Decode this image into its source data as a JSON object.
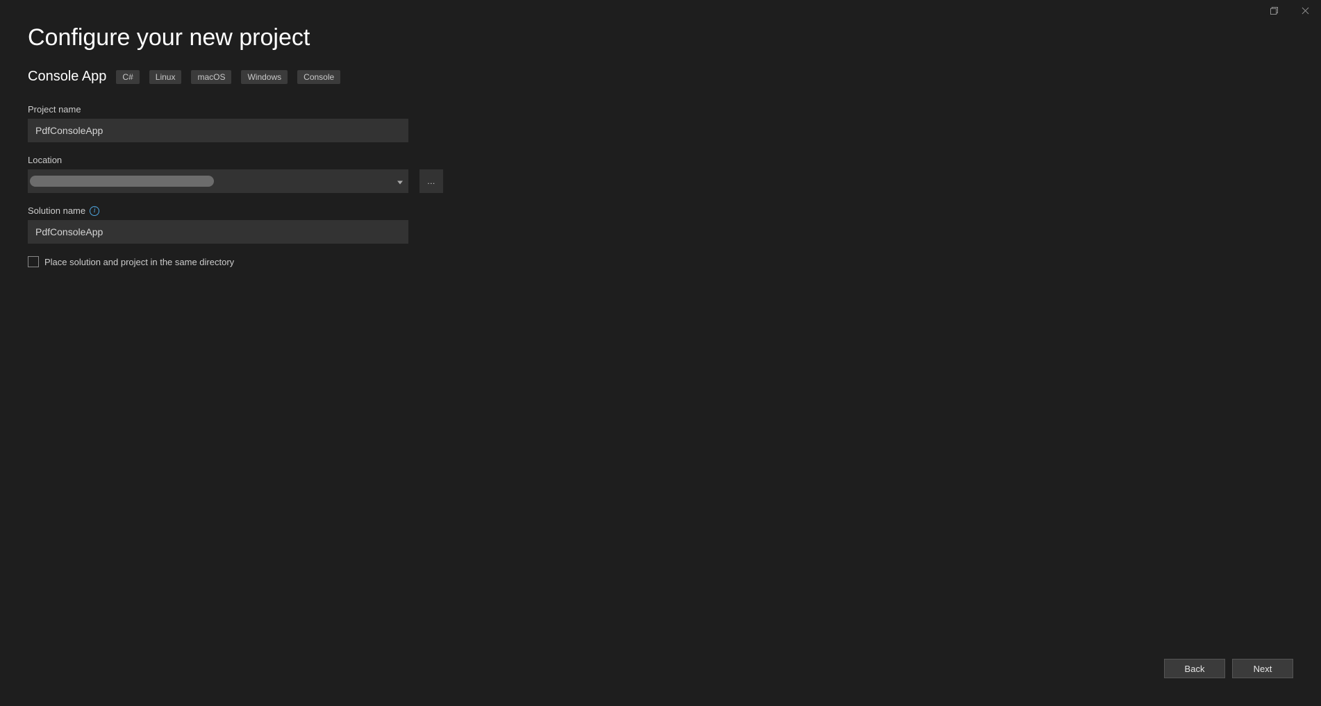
{
  "title_bar": {
    "maximize_icon": "maximize",
    "close_icon": "close"
  },
  "header": {
    "title": "Configure your new project",
    "template_name": "Console App",
    "tags": [
      "C#",
      "Linux",
      "macOS",
      "Windows",
      "Console"
    ]
  },
  "form": {
    "project_name": {
      "label": "Project name",
      "value": "PdfConsoleApp"
    },
    "location": {
      "label": "Location",
      "value": "",
      "browse_label": "..."
    },
    "solution_name": {
      "label": "Solution name",
      "value": "PdfConsoleApp"
    },
    "same_directory": {
      "label": "Place solution and project in the same directory",
      "checked": false
    }
  },
  "footer": {
    "back_label": "Back",
    "next_label": "Next"
  }
}
